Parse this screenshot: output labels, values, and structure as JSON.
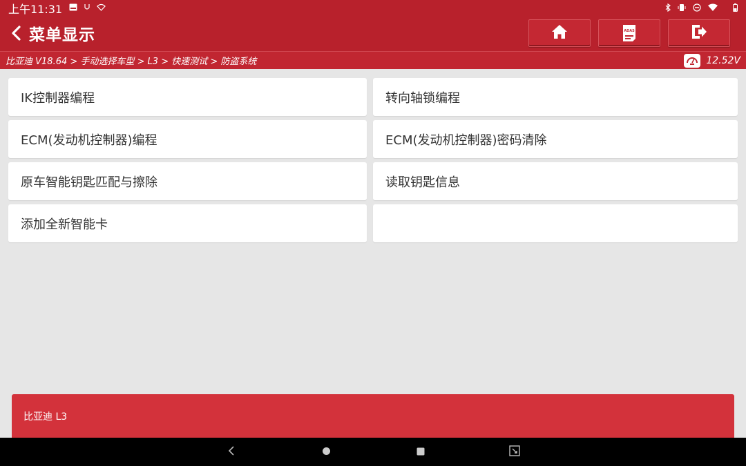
{
  "status_bar": {
    "time": "上午11:31",
    "left_icons": [
      "image-icon",
      "usb-icon",
      "wifi-icon"
    ],
    "right_icons": [
      "bluetooth-icon",
      "vibrate-icon",
      "dnd-icon",
      "wifi-icon",
      "battery-icon"
    ]
  },
  "header": {
    "title": "菜单显示",
    "buttons": [
      "home-icon",
      "adas-icon",
      "exit-icon"
    ],
    "adas_label": "ADAS"
  },
  "breadcrumb": {
    "path": "比亚迪 V18.64 > 手动选择车型 > L3 > 快速测试 > 防盗系统",
    "voltage": "12.52V"
  },
  "menu": {
    "items": [
      "IK控制器编程",
      "转向轴锁编程",
      "ECM(发动机控制器)编程",
      "ECM(发动机控制器)密码清除",
      "原车智能钥匙匹配与擦除",
      "读取钥匙信息",
      "添加全新智能卡",
      ""
    ]
  },
  "footer": {
    "vehicle": "比亚迪 L3"
  },
  "colors": {
    "header": "#b8212c",
    "breadcrumb": "#c12631",
    "footer": "#d3323b",
    "background": "#e6e6e6"
  }
}
